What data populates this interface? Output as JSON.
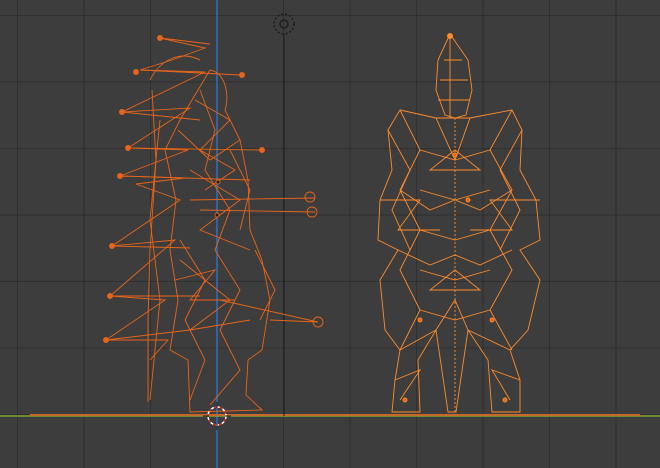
{
  "app": {
    "view": "blender-3d-viewport-front-orthographic",
    "shading": "wireframe"
  },
  "colors": {
    "background": "#3d3d3d",
    "grid": "#333333",
    "axis_x": "#7ea236",
    "axis_z": "#2f6fc4",
    "selected_active": "#ff8b2b",
    "selected": "#e8651a",
    "cursor": "#ffffff"
  },
  "objects": [
    {
      "name_icon": "armored-warrior-side-view",
      "state": "selected"
    },
    {
      "name_icon": "armored-warrior-front-view",
      "state": "selected-active"
    }
  ],
  "icons": {
    "camera": "camera-object-icon",
    "cursor": "3d-cursor-icon"
  }
}
